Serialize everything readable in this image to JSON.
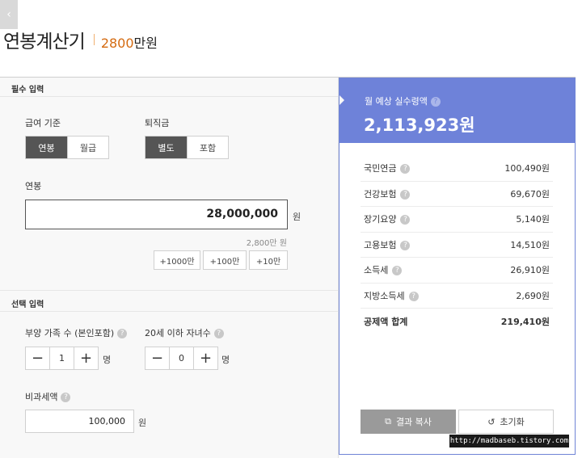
{
  "header": {
    "back_icon": "chevron-left-icon",
    "title": "연봉계산기",
    "amount_number": "2800",
    "amount_unit": "만원"
  },
  "required": {
    "section_title": "필수 입력",
    "pay_basis": {
      "label": "급여 기준",
      "options": [
        "연봉",
        "월급"
      ],
      "selected": "연봉"
    },
    "severance": {
      "label": "퇴직금",
      "options": [
        "별도",
        "포함"
      ],
      "selected": "별도"
    },
    "salary": {
      "label": "연봉",
      "value": "28,000,000",
      "unit": "원",
      "hint": "2,800만 원"
    },
    "quick_buttons": [
      "+1000만",
      "+100만",
      "+10만"
    ]
  },
  "optional": {
    "section_title": "선택 입력",
    "dependents": {
      "label": "부양 가족 수 (본인포함)",
      "value": "1",
      "unit": "명"
    },
    "children": {
      "label": "20세 이하 자녀수",
      "value": "0",
      "unit": "명"
    },
    "non_taxable": {
      "label": "비과세액",
      "value": "100,000",
      "unit": "원"
    }
  },
  "result": {
    "label": "월 예상 실수령액",
    "value": "2,113,923원",
    "deductions": [
      {
        "name": "국민연금",
        "amount": "100,490원"
      },
      {
        "name": "건강보험",
        "amount": "69,670원"
      },
      {
        "name": "장기요양",
        "amount": "5,140원"
      },
      {
        "name": "고용보험",
        "amount": "14,510원"
      },
      {
        "name": "소득세",
        "amount": "26,910원"
      },
      {
        "name": "지방소득세",
        "amount": "2,690원"
      }
    ],
    "total": {
      "name": "공제액 합계",
      "amount": "219,410원"
    },
    "copy_button": "결과 복사",
    "reset_button": "초기화"
  },
  "help_glyph": "?",
  "watermark": "http://madbaseb.tistory.com",
  "colors": {
    "accent": "#6e82d9",
    "amount_orange": "#d46a10",
    "active_segment": "#555555",
    "copy_button": "#9a9a9a"
  }
}
